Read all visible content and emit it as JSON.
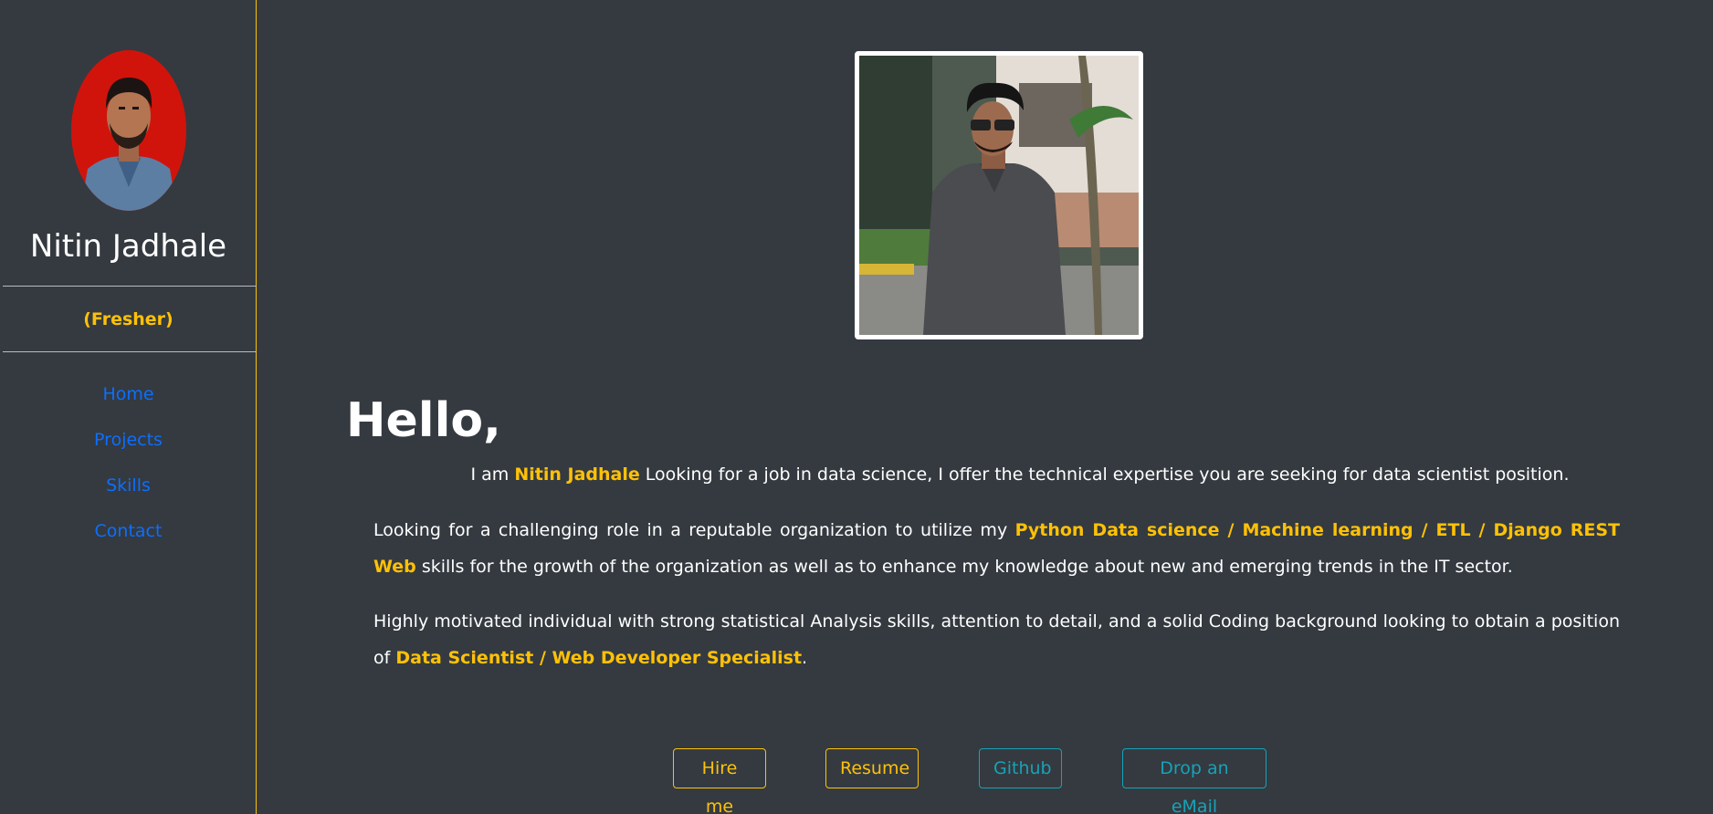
{
  "sidebar": {
    "name": "Nitin Jadhale",
    "status": "(Fresher)",
    "nav": {
      "home": "Home",
      "projects": "Projects",
      "skills": "Skills",
      "contact": "Contact"
    }
  },
  "main": {
    "greeting": "Hello,",
    "intro": {
      "prefix": "I am ",
      "name": "Nitin Jadhale",
      "suffix": " Looking for a job in data science, I offer the technical expertise you are seeking for data scientist position."
    },
    "paragraph1": {
      "before": "Looking for a challenging role in a reputable organization to utilize my ",
      "highlight": "Python Data science / Machine learning / ETL / Django REST Web",
      "after": " skills for the growth of the organization as well as to enhance my knowledge about new and emerging trends in the IT sector."
    },
    "paragraph2": {
      "before": "Highly motivated individual with strong statistical Analysis skills, attention to detail, and a solid Coding background looking to obtain a position of ",
      "highlight": "Data Scientist / Web Developer Specialist",
      "after": "."
    },
    "buttons": {
      "hire": "Hire me",
      "resume": "Resume",
      "github": "Github",
      "email": "Drop an eMail"
    }
  },
  "colors": {
    "background": "#343a40",
    "accent": "#ffc107",
    "link": "#0d6efd",
    "info": "#17a2b8"
  },
  "icons": {
    "avatar": "profile-photo-red-background",
    "hero": "profile-photo-outdoor"
  }
}
